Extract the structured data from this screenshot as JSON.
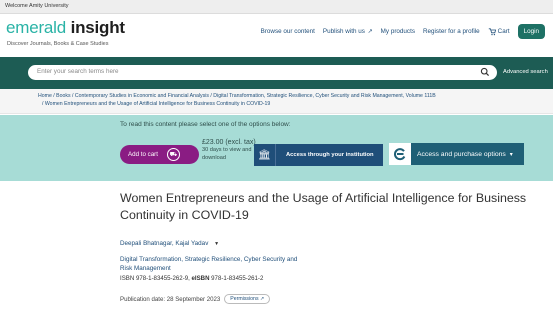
{
  "top_bar": {
    "welcome_text": "Welcome Amity University"
  },
  "header": {
    "logo_part1": "emerald",
    "logo_part2": "insight",
    "tagline": "Discover Journals, Books & Case Studies",
    "nav": {
      "browse": "Browse our content",
      "publish": "Publish with us",
      "products": "My products",
      "register": "Register for a profile",
      "cart": "Cart",
      "login": "Login"
    }
  },
  "search": {
    "placeholder": "Enter your search terms here",
    "advanced": "Advanced search"
  },
  "breadcrumb": {
    "line1": "Home / Books / Contemporary Studies in Economic and Financial Analysis / Digital Transformation, Strategic Resilience, Cyber Security and Risk Management, Volume 111B",
    "line2": "/ Women Entrepreneurs and the Usage of Artificial Intelligence for Business Continuity in COVID-19"
  },
  "purchase": {
    "prompt": "To read this content please select one of the options below:",
    "add_to_cart": "Add to cart",
    "price": "£23.00 (excl. tax)",
    "price_note_1": "30 days to view and",
    "price_note_2": "download",
    "institution": "Access through your institution",
    "access_options": "Access and purchase options"
  },
  "chapter": {
    "title": "Women Entrepreneurs and the Usage of Artificial Intelligence for Business Continuity in COVID-19",
    "authors": "Deepali Bhatnagar, Kajal Yadav",
    "book_line1": "Digital Transformation, Strategic Resilience, Cyber Security and",
    "book_line2": "Risk Management",
    "isbn_label": "ISBN",
    "isbn": "978-1-83455-262-9,",
    "eisbn_label": "eISBN",
    "eisbn": "978-1-83455-261-2",
    "pub_date": "Publication date: 28 September 2023",
    "permissions": "Permissions"
  },
  "colors": {
    "brand_teal": "#2ab3a6",
    "search_bar": "#1d5c54",
    "purchase_panel": "#a7dcd6",
    "add_to_cart": "#8a1c83",
    "institution_button": "#1f4e79",
    "access_button": "#1f5f76",
    "link": "#1f4e79"
  },
  "icons": {
    "external": "external-link-icon",
    "cart": "cart-icon",
    "search": "search-icon",
    "institution": "institution-icon",
    "access": "access-logo-icon",
    "chevron": "chevron-down-icon"
  }
}
